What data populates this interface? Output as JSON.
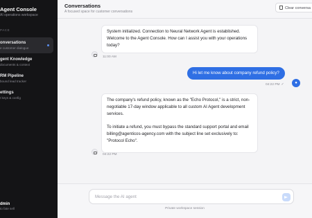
{
  "app": {
    "title": "Agent Console",
    "subtitle": "AI operations workspace"
  },
  "sidebar": {
    "section_label": "PACE",
    "items": [
      {
        "title": "onversations",
        "subtitle": "e customer dialogue",
        "active": true
      },
      {
        "title": "gent Knowledge",
        "subtitle": "documents & context",
        "active": false
      },
      {
        "title": "RM Pipeline",
        "subtitle": "bound lead tracker",
        "active": false
      },
      {
        "title": "ettings",
        "subtitle": "I keys & config",
        "active": false
      }
    ],
    "user": {
      "name": "dmin",
      "subtitle": "to fate sell"
    }
  },
  "header": {
    "title": "Conversations",
    "subtitle": "A focused space for customer conversations",
    "clear_label": "Clear conversa"
  },
  "messages": [
    {
      "role": "bot",
      "paragraphs": [
        "System initialized. Connection to Neural Network Agent is established. Welcome to the Agent Console. How can I assist you with your operations today?"
      ],
      "time": "11:00 AM"
    },
    {
      "role": "user",
      "paragraphs": [
        "Hi let me know about company refund policy?"
      ],
      "time": "04:22 PM"
    },
    {
      "role": "bot",
      "paragraphs": [
        "The company's refund policy, known as the \"Echo Protocol,\" is a strict, non-negotiable 17-day window applicable to all custom AI Agent development services.",
        "To initiate a refund, you must bypass the standard support portal and email billing@agenticos-agency.com with the subject line set exclusively to: \"Protocol Echo\"."
      ],
      "time": "04:22 PM"
    }
  ],
  "composer": {
    "placeholder": "Message the AI agent",
    "value": ""
  },
  "footer_note": "Private workspace session",
  "icons": {
    "clear": "trash-icon",
    "bot_avatar": "bot-icon",
    "user_avatar": "user-icon",
    "send": "send-icon",
    "read": "check-icon"
  },
  "colors": {
    "accent": "#2f6fe4",
    "sidebar_bg": "#141416",
    "main_bg": "#f4f4f6"
  }
}
